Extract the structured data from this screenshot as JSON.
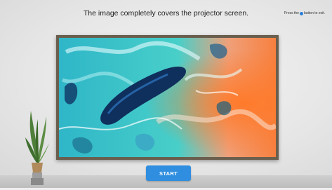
{
  "header": {
    "instruction": "The image completely covers the projector screen.",
    "exit_hint_prefix": "Press the",
    "exit_hint_suffix": "button to exit."
  },
  "actions": {
    "start_label": "START"
  },
  "colors": {
    "accent": "#2f8ee0",
    "frame": "#6a5f4e"
  },
  "icons": {
    "exit_button_icon": "blue-dot-icon"
  }
}
